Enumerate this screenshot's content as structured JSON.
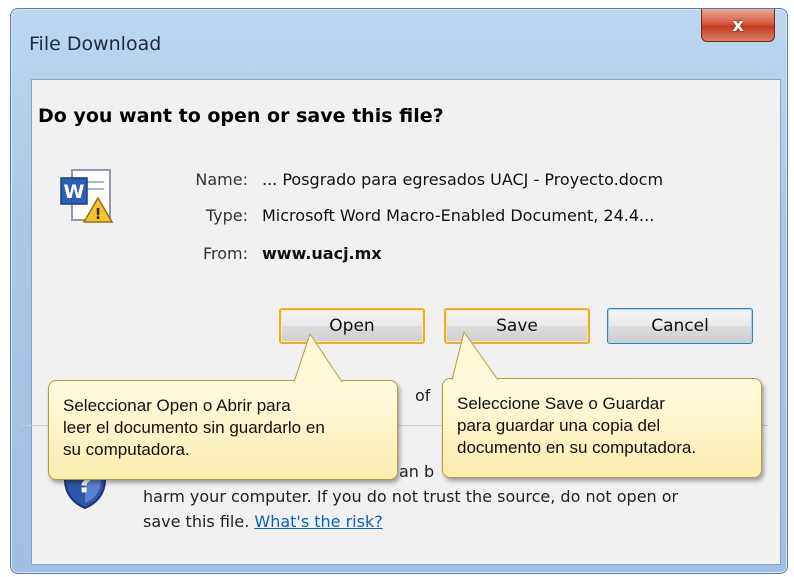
{
  "window": {
    "title": "File Download",
    "close_label": "x"
  },
  "dialog": {
    "question": "Do you want to open or save this file?",
    "name_label": "Name:",
    "name_value": "... Posgrado para egresados UACJ - Proyecto.docm",
    "type_label": "Type:",
    "type_value": "Microsoft Word Macro-Enabled Document, 24.4...",
    "from_label": "From:",
    "from_value": "www.uacj.mx",
    "file_icon": "word-document-icon"
  },
  "buttons": {
    "open": "Open",
    "save": "Save",
    "cancel": "Cancel"
  },
  "warning": {
    "icon": "shield-question-icon",
    "fragment_of": "of",
    "fragment_an_b": "an b",
    "line2": "harm your computer. If you do not trust the source, do not open or",
    "line3_prefix": "save this file.",
    "risk_link": "What's the risk?"
  },
  "callouts": {
    "open": [
      "Seleccionar Open o Abrir para",
      "leer el documento sin guardarlo en",
      "su computadora."
    ],
    "save": [
      "Seleccione Save o Guardar",
      "para guardar una copia del",
      "documento en su computadora."
    ]
  },
  "colors": {
    "callout_fill": "#fbedb0",
    "highlight_border": "#e7b030",
    "link": "#0b5fc1"
  }
}
